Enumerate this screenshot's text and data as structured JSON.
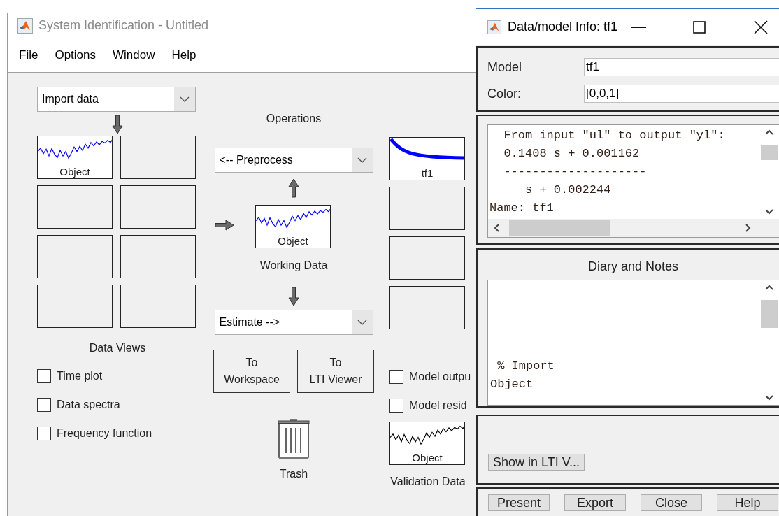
{
  "main_window": {
    "title": "System Identification - Untitled"
  },
  "menu": [
    "File",
    "Options",
    "Window",
    "Help"
  ],
  "import_dropdown": {
    "value": "Import data"
  },
  "data_boards": [
    {
      "kind": "signal",
      "label": "Object",
      "color": "#0000ff"
    },
    {
      "kind": "empty"
    },
    {
      "kind": "empty"
    },
    {
      "kind": "empty"
    },
    {
      "kind": "empty"
    },
    {
      "kind": "empty"
    },
    {
      "kind": "empty"
    },
    {
      "kind": "empty"
    }
  ],
  "data_views": {
    "title": "Data Views",
    "options": [
      {
        "label": "Time plot",
        "checked": false
      },
      {
        "label": "Data spectra",
        "checked": false
      },
      {
        "label": "Frequency function",
        "checked": false
      }
    ]
  },
  "operations": {
    "title": "Operations",
    "preprocess": {
      "value": "<-- Preprocess"
    },
    "working_data": {
      "kind": "signal",
      "label": "Object",
      "color": "#0000ff"
    },
    "working_data_caption": "Working Data",
    "estimate": {
      "value": "Estimate -->"
    },
    "buttons": [
      {
        "lines": [
          "To",
          "Workspace"
        ]
      },
      {
        "lines": [
          "To",
          "LTI Viewer"
        ]
      }
    ],
    "trash": "Trash"
  },
  "model_boards": [
    {
      "kind": "model",
      "label": "tf1",
      "color": "#0000ff"
    },
    {
      "kind": "empty"
    },
    {
      "kind": "empty"
    },
    {
      "kind": "empty"
    }
  ],
  "model_views": [
    {
      "label": "Model outpu",
      "checked": false
    },
    {
      "label": "Model resid",
      "checked": false
    }
  ],
  "validation_data": {
    "board": {
      "kind": "signal",
      "label": "Object",
      "color": "#000000"
    },
    "caption": "Validation Data"
  },
  "dialog": {
    "title": "Data/model Info: tf1",
    "fields": [
      {
        "label": "Model",
        "value": "tf1"
      },
      {
        "label": "Color:",
        "value": "[0,0,1]"
      }
    ],
    "info_lines": [
      "  From input \"ul\" to output \"yl\":",
      "  0.1408 s + 0.001162",
      "  --------------------",
      "     s + 0.002244",
      "Name: tf1"
    ],
    "diary": {
      "title": "Diary and Notes",
      "lines": [
        " % Import",
        "Object"
      ]
    },
    "show_button": "Show in LTI V...",
    "buttons": [
      "Present",
      "Export",
      "Close",
      "Help"
    ]
  }
}
